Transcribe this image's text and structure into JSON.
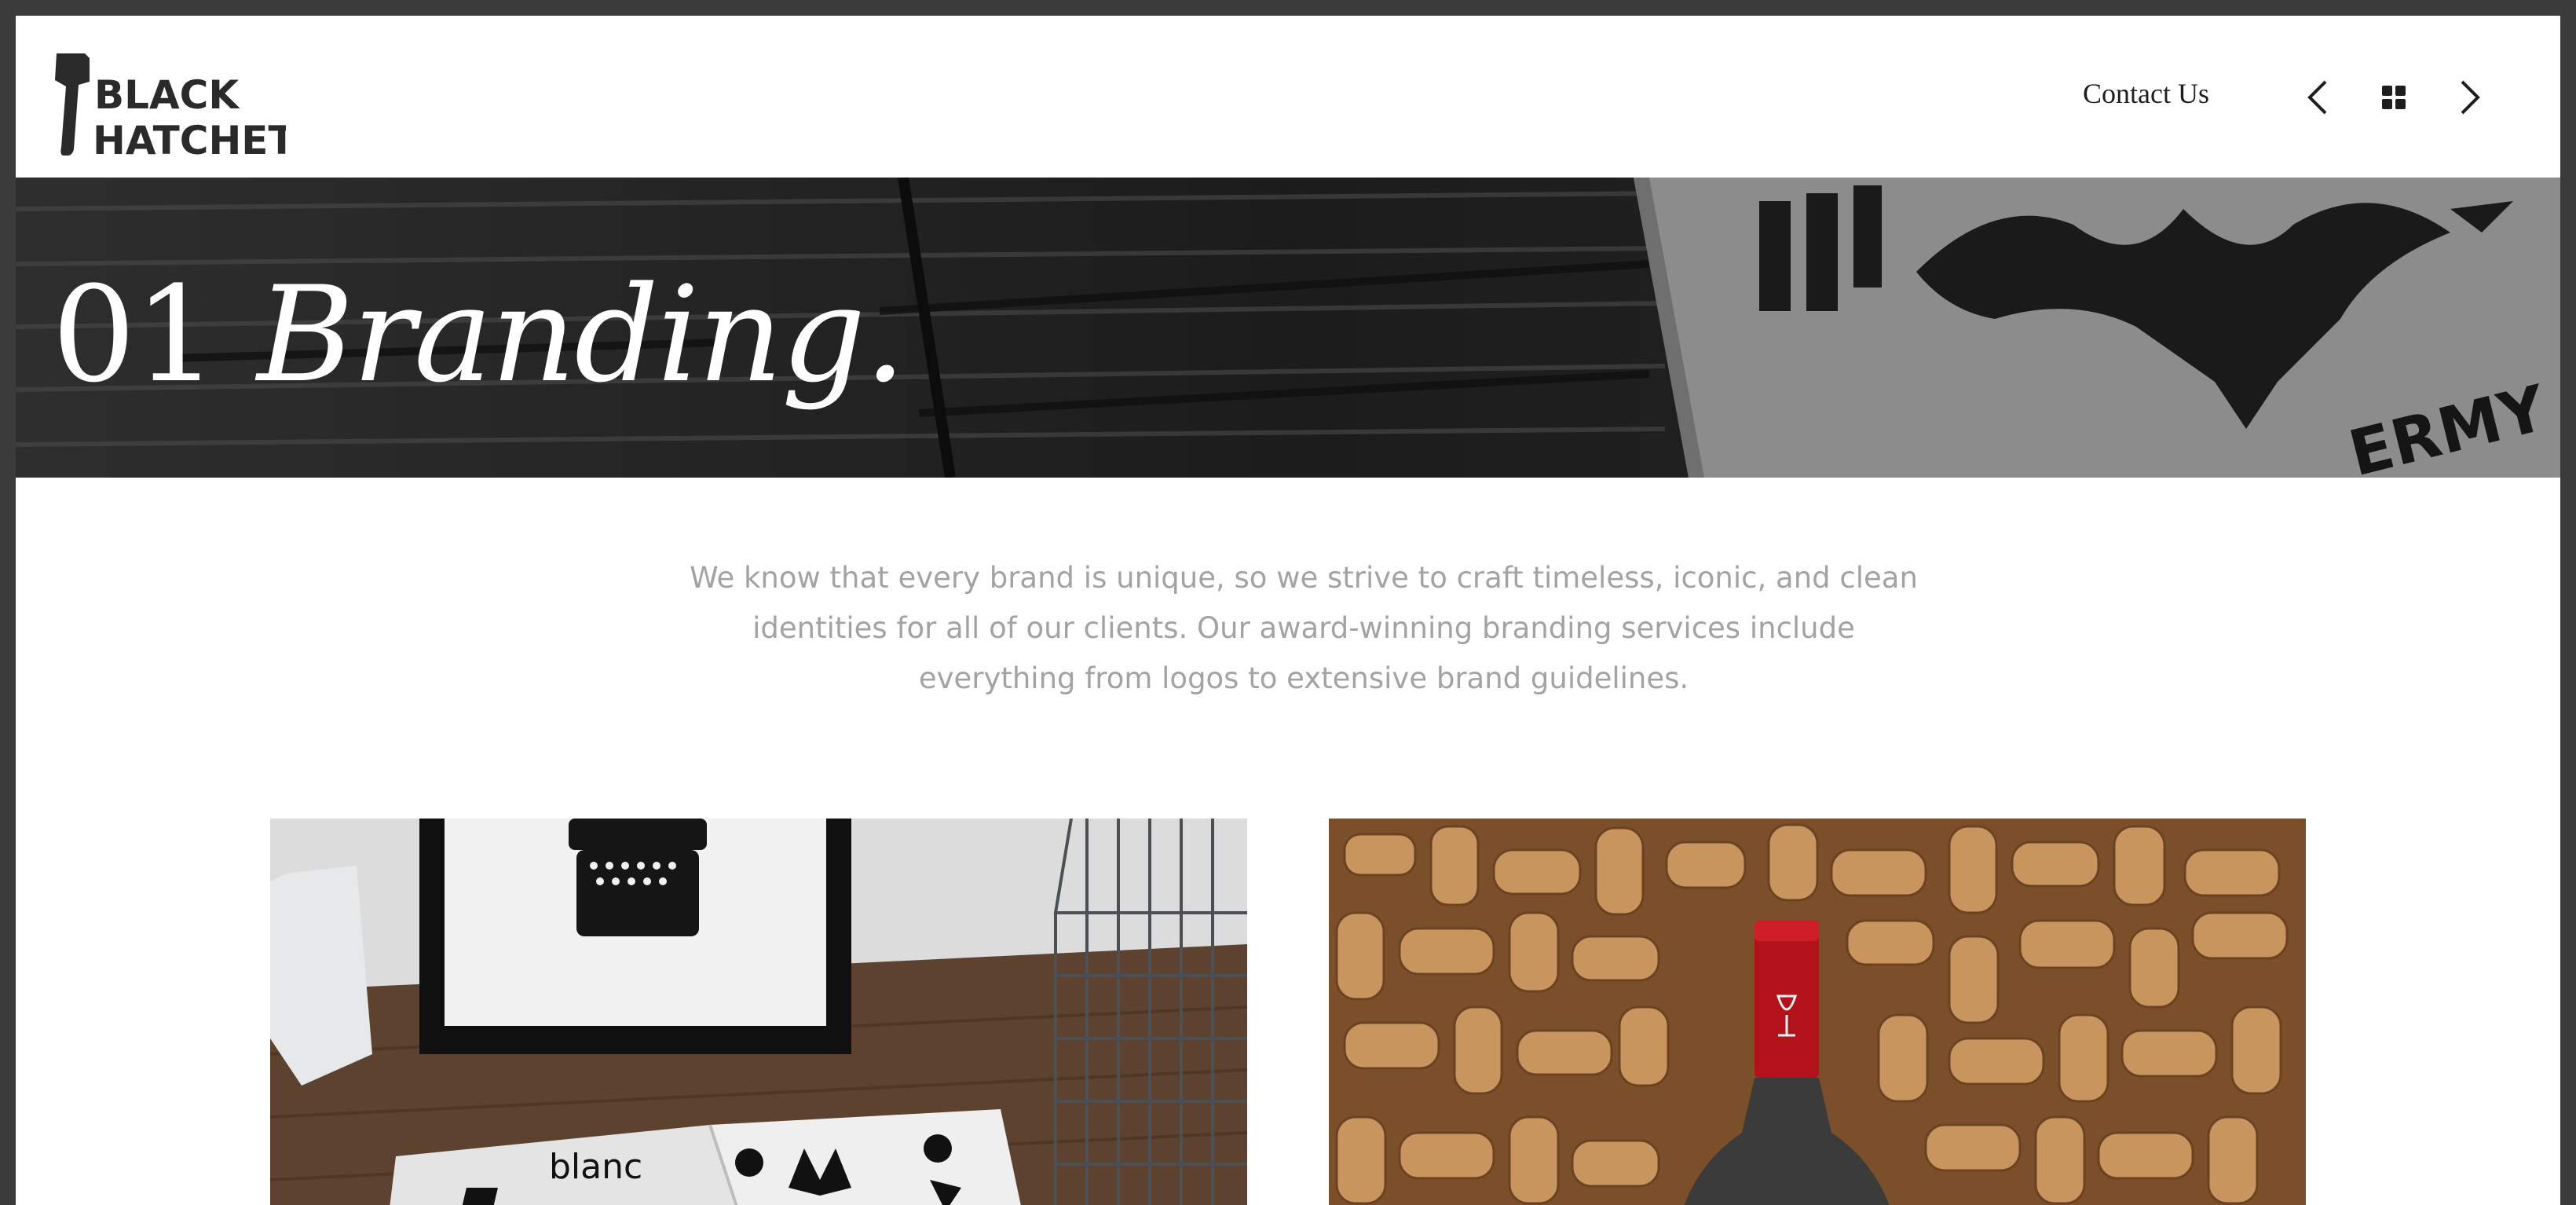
{
  "brand": {
    "logo_line1": "BLACK",
    "logo_line2": "HATCHET",
    "logo_icon": "hatchet-icon"
  },
  "nav": {
    "contact_label": "Contact Us",
    "prev_icon": "chevron-left-icon",
    "grid_icon": "grid-icon",
    "next_icon": "chevron-right-icon"
  },
  "hero": {
    "number": "01",
    "title": "Branding."
  },
  "intro": {
    "text": "We know that every brand is unique, so we strive to craft timeless, iconic, and clean identities for all of our clients. Our award-winning branding services include everything from logos to extensive brand guidelines."
  },
  "projects": [
    {
      "label": "blanc",
      "image": "logo-book-mockup"
    },
    {
      "label": "",
      "image": "wine-bottle-corks"
    }
  ],
  "colors": {
    "outer_frame": "#3b3b3b",
    "page_bg": "#ffffff",
    "text_dark": "#1e1e1e",
    "intro_text": "#a3a3a3",
    "hero_text": "#ffffff"
  }
}
